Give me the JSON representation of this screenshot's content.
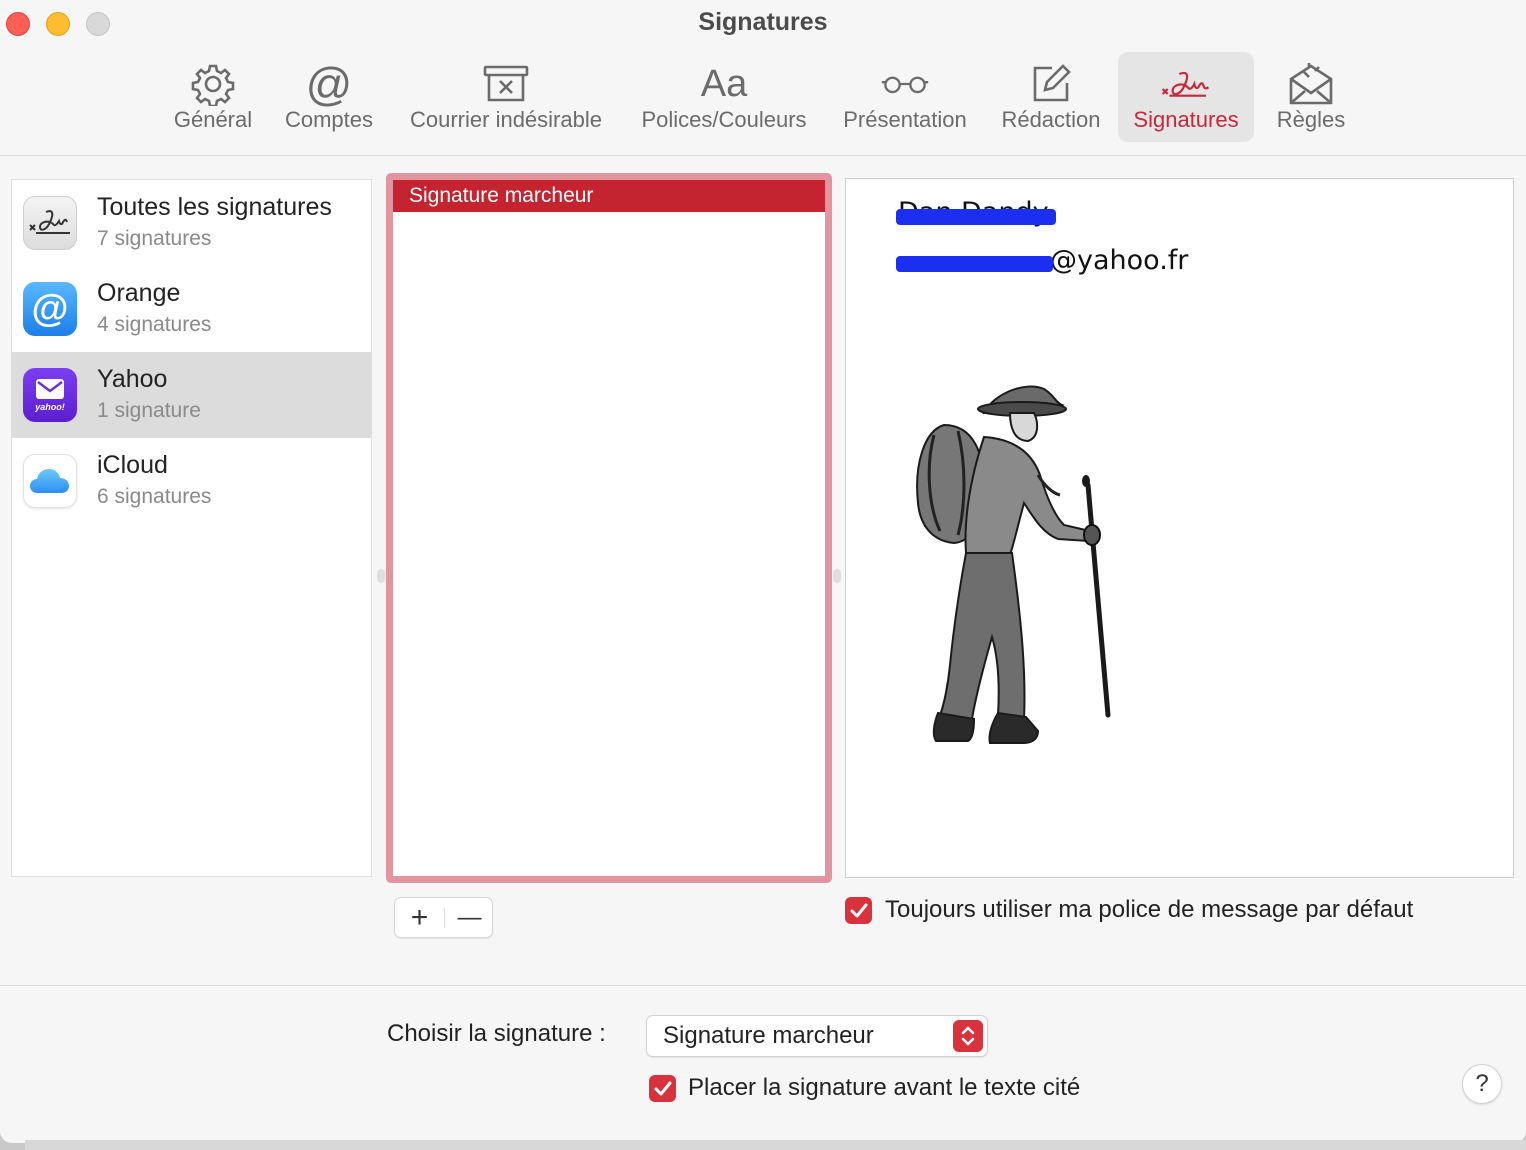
{
  "window": {
    "title": "Signatures"
  },
  "toolbar": {
    "items": [
      {
        "label": "Général",
        "icon": "gear-icon"
      },
      {
        "label": "Comptes",
        "icon": "at-icon"
      },
      {
        "label": "Courrier indésirable",
        "icon": "junk-tray-icon"
      },
      {
        "label": "Polices/Couleurs",
        "icon": "fonts-aa-icon"
      },
      {
        "label": "Présentation",
        "icon": "glasses-icon"
      },
      {
        "label": "Rédaction",
        "icon": "compose-icon"
      },
      {
        "label": "Signatures",
        "icon": "signature-icon",
        "active": true
      },
      {
        "label": "Règles",
        "icon": "rules-envelope-icon"
      }
    ]
  },
  "accounts": [
    {
      "name": "Toutes les signatures",
      "count": "7 signatures",
      "icon": "signature-app-icon"
    },
    {
      "name": "Orange",
      "count": "4 signatures",
      "icon": "at-mail-icon"
    },
    {
      "name": "Yahoo",
      "count": "1 signature",
      "icon": "yahoo-mail-icon",
      "selected": true
    },
    {
      "name": "iCloud",
      "count": "6 signatures",
      "icon": "icloud-icon"
    }
  ],
  "signatures": {
    "items": [
      {
        "name": "Signature marcheur",
        "selected": true
      }
    ],
    "add_label": "+",
    "remove_label": "—"
  },
  "preview": {
    "name_line": "Dan Dandy",
    "email_visible": "@yahoo.fr",
    "image": "hiker-drawing"
  },
  "options": {
    "default_font_label": "Toujours utiliser ma police de message par défaut",
    "default_font_checked": true
  },
  "bottom": {
    "choose_label": "Choisir la signature :",
    "choose_value": "Signature marcheur",
    "place_before_label": "Placer la signature avant le texte cité",
    "place_before_checked": true,
    "help_label": "?"
  },
  "colors": {
    "accent": "#c42330",
    "checkbox": "#d8323c",
    "active_tab_text": "#c8283a",
    "redaction": "#1b2ff0"
  }
}
